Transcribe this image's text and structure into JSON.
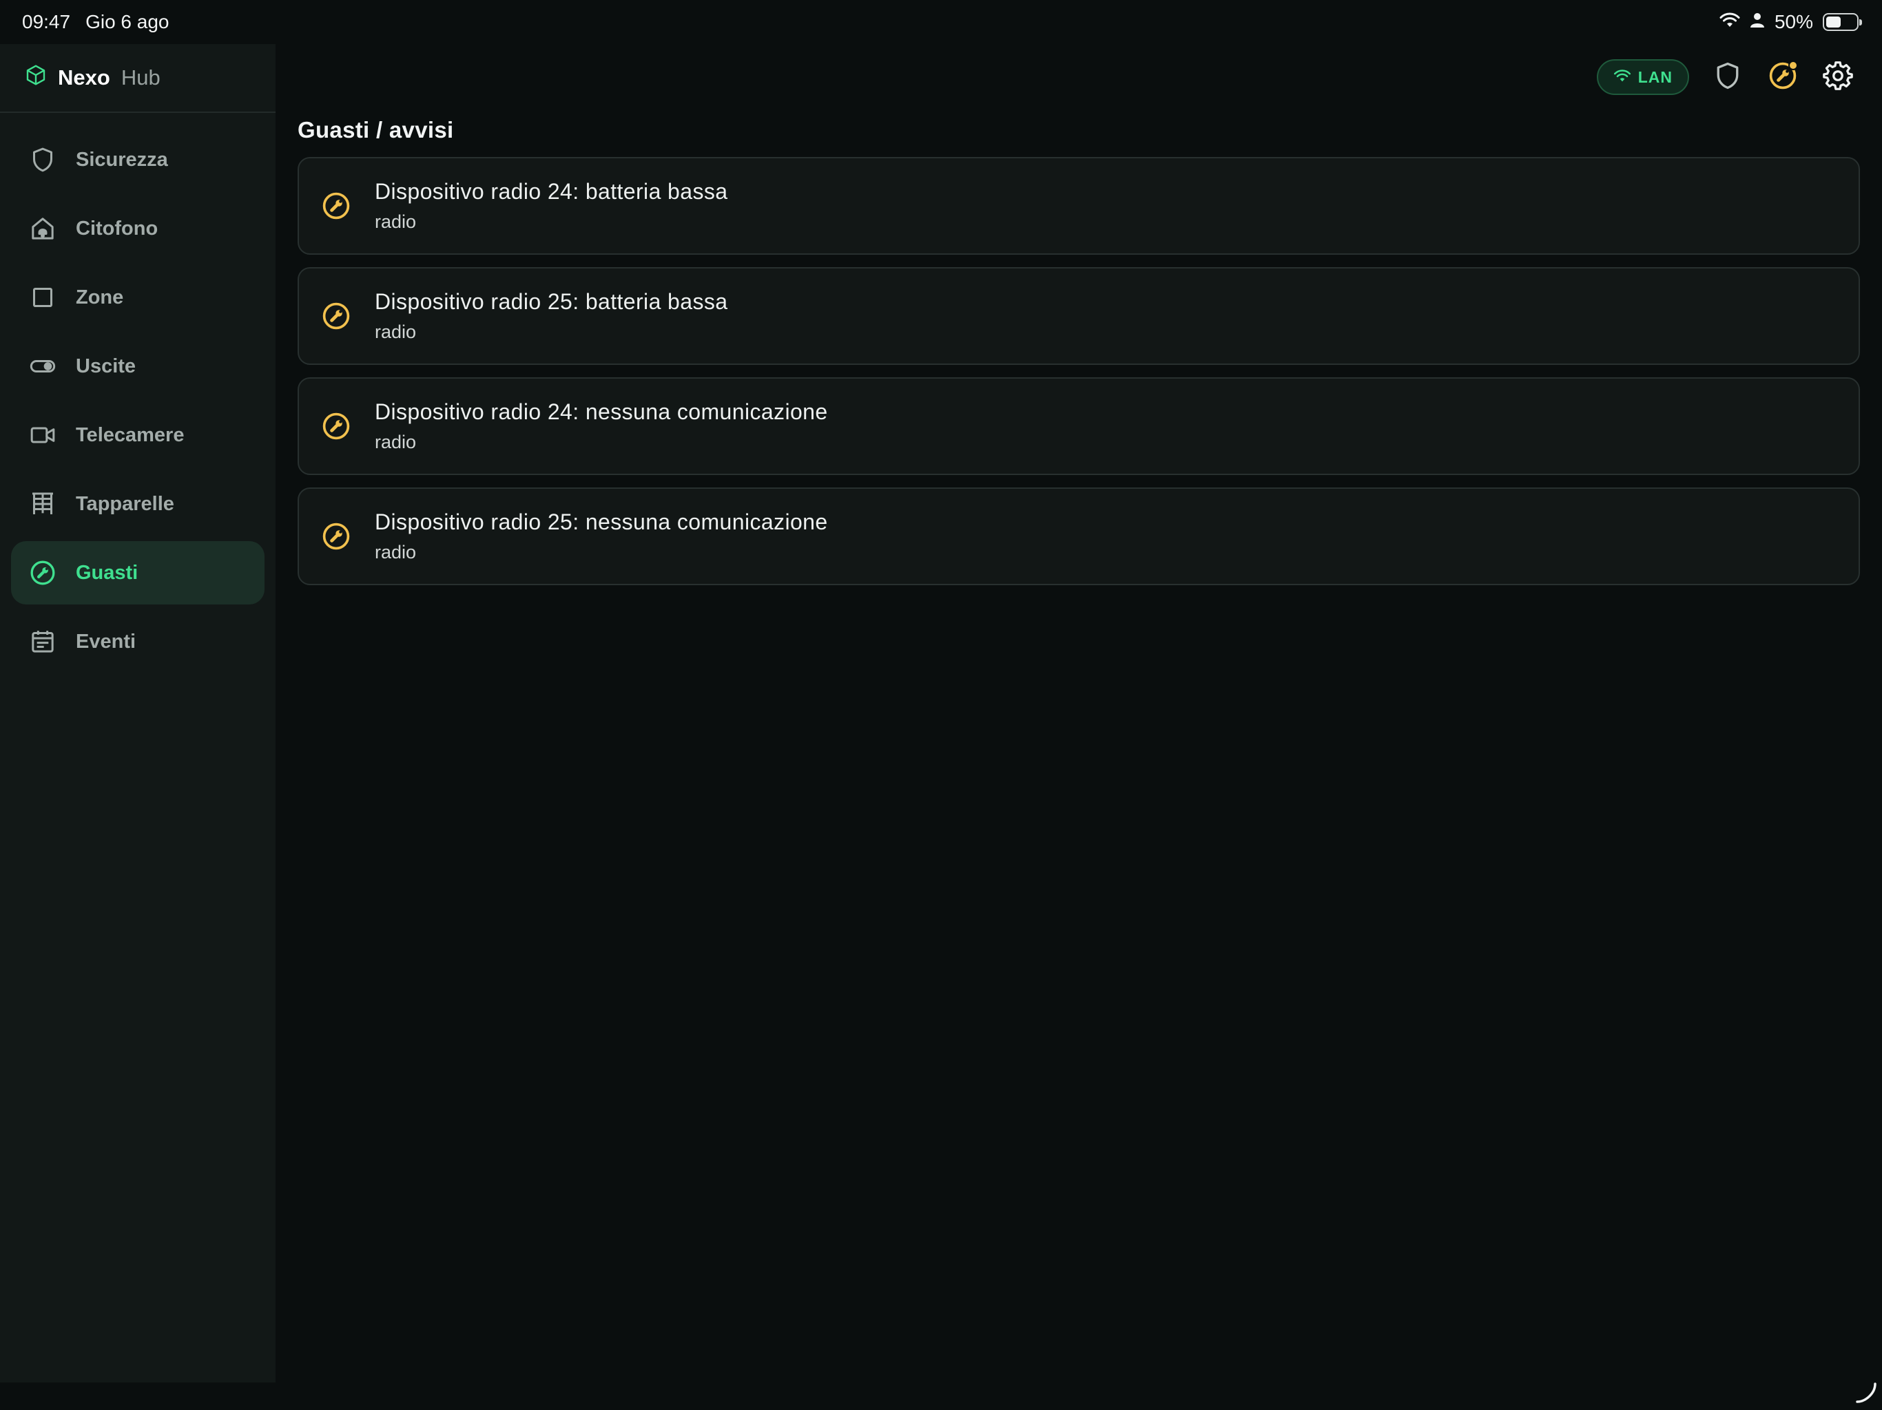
{
  "status_bar": {
    "time": "09:47",
    "date": "Gio 6 ago",
    "battery": "50%",
    "battery_level": 0.5
  },
  "brand": {
    "name_bold": "Nexo",
    "name_light": "Hub",
    "icon": "cube-icon"
  },
  "sidebar": {
    "items": [
      {
        "label": "Sicurezza",
        "icon": "shield-icon",
        "active": false
      },
      {
        "label": "Citofono",
        "icon": "intercom-icon",
        "active": false
      },
      {
        "label": "Zone",
        "icon": "square-icon",
        "active": false
      },
      {
        "label": "Uscite",
        "icon": "toggle-icon",
        "active": false
      },
      {
        "label": "Telecamere",
        "icon": "camera-icon",
        "active": false
      },
      {
        "label": "Tapparelle",
        "icon": "blinds-icon",
        "active": false
      },
      {
        "label": "Guasti",
        "icon": "wrench-circle-icon",
        "active": true
      },
      {
        "label": "Eventi",
        "icon": "calendar-icon",
        "active": false
      }
    ]
  },
  "toolbar": {
    "lan_label": "LAN"
  },
  "main": {
    "title": "Guasti / avvisi",
    "faults": [
      {
        "title": "Dispositivo radio 24: batteria bassa",
        "subtitle": "radio"
      },
      {
        "title": "Dispositivo radio 25: batteria bassa",
        "subtitle": "radio"
      },
      {
        "title": "Dispositivo radio 24: nessuna comunicazione",
        "subtitle": "radio"
      },
      {
        "title": "Dispositivo radio 25: nessuna comunicazione",
        "subtitle": "radio"
      }
    ]
  },
  "colors": {
    "accent": "#3fe08f",
    "warning": "#f2c14e",
    "background": "#0a0e0e",
    "sidebar": "#121817"
  }
}
